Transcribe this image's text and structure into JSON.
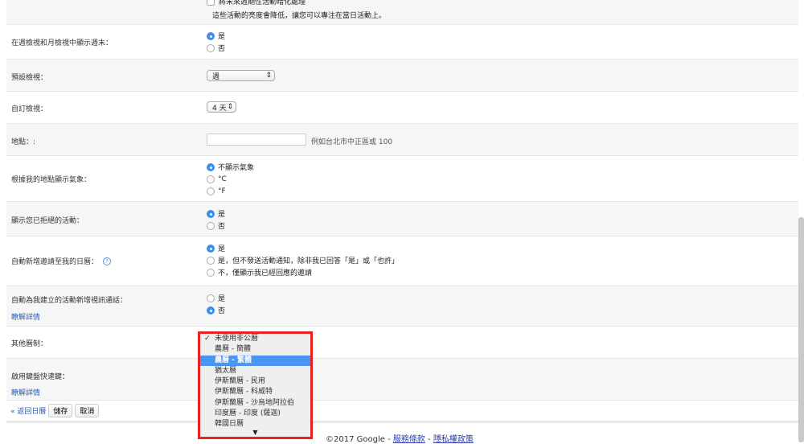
{
  "dim_row": {
    "checkbox_label": "將未來週期性活動暗化處理",
    "note": "這些活動的亮度會降低，讓您可以專注在當日活動上。"
  },
  "weekend": {
    "label": "在週檢視和月檢視中顯示週末：",
    "options": [
      "是",
      "否"
    ],
    "selected": 0
  },
  "default_view": {
    "label": "預設檢視：",
    "value": "週"
  },
  "custom_view": {
    "label": "自訂檢視：",
    "value": "4 天"
  },
  "location": {
    "label": "地點：:",
    "value": "",
    "hint": "例如台北市中正區或 100"
  },
  "weather": {
    "label": "根據我的地點顯示氣象：",
    "options": [
      "不顯示氣象",
      "°C",
      "°F"
    ],
    "selected": 0
  },
  "declined": {
    "label": "顯示您已拒絕的活動：",
    "options": [
      "是",
      "否"
    ],
    "selected": 0
  },
  "auto_add": {
    "label": "自動新增邀請至我的日曆：",
    "options": [
      "是",
      "是，但不發送活動通知，除非我已回答「是」或「也許」",
      "不，僅顯示我已經回應的邀請"
    ],
    "selected": 0
  },
  "video": {
    "label": "自動為我建立的活動新增視訊通話：",
    "learn_more": "瞭解詳情",
    "options": [
      "是",
      "否"
    ],
    "selected": 1
  },
  "other_cal": {
    "label": "其他曆制：",
    "options": [
      "未使用非公曆",
      "農曆 - 簡體",
      "農曆 - 繁體",
      "猶太曆",
      "伊斯蘭曆 - 民用",
      "伊斯蘭曆 - 科威特",
      "伊斯蘭曆 - 沙烏地阿拉伯",
      "印度曆 - 印度 (薩迦)",
      "韓國日曆"
    ],
    "checked": 0,
    "highlighted": 2
  },
  "keyboard": {
    "label": "啟用鍵盤快速鍵：",
    "learn_more": "瞭解詳情"
  },
  "actions": {
    "back": "« 返回日曆",
    "save": "儲存",
    "cancel": "取消"
  },
  "footer": {
    "copyright": "©2017 Google - ",
    "terms": "服務條款",
    "sep": " - ",
    "privacy": "隱私權政策"
  }
}
